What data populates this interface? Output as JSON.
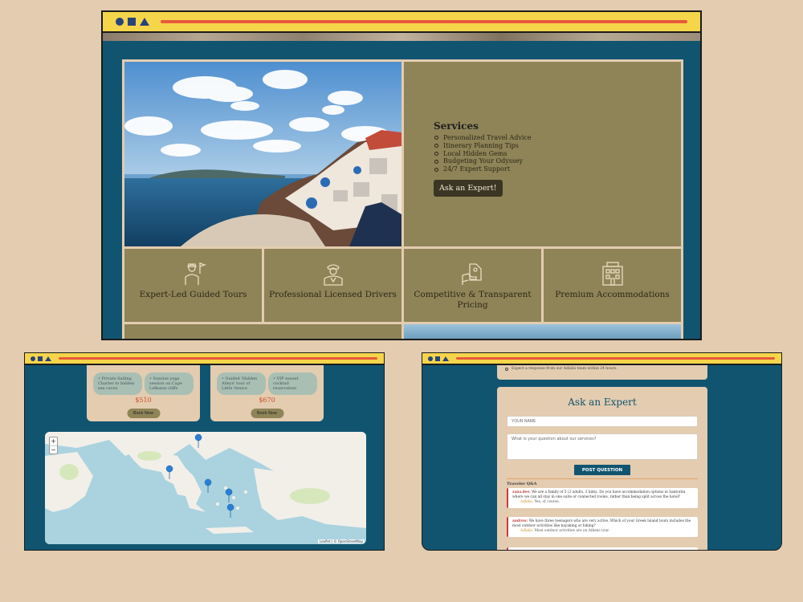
{
  "services": {
    "title": "Services",
    "items": [
      "Personalized Travel Advice",
      "Itinerary Planning Tips",
      "Local Hidden Gems",
      "Budgeting Your Odyssey",
      "24/7 Expert Support"
    ],
    "cta": "Ask an Expert!"
  },
  "features": [
    {
      "label": "Expert-Led Guided Tours",
      "icon": "tour-guide-icon"
    },
    {
      "label": "Professional Licensed Drivers",
      "icon": "driver-icon"
    },
    {
      "label": "Competitive & Transparent Pricing",
      "icon": "pricing-icon"
    },
    {
      "label": "Premium Accommodations",
      "icon": "hotel-icon"
    }
  ],
  "tours": [
    {
      "features": [
        "• Private Sailing Charter to hidden sea caves",
        "• Sunrise yoga session on Cape Lefkatas cliffs"
      ],
      "price": "$510",
      "book": "Book Now"
    },
    {
      "features": [
        "• Guided 'Hidden Alleys' tour of Little Venice",
        "• VIP sunset cocktail reservation"
      ],
      "price": "$670",
      "book": "Book Now"
    }
  ],
  "map": {
    "zoom_in": "+",
    "zoom_out": "−",
    "attribution": "Leaflet | © OpenStreetMap"
  },
  "ask": {
    "top_note": "Expect a response from our Adlalis team within 24 hours.",
    "title": "Ask an Expert",
    "name_placeholder": "YOUR NAME",
    "question_placeholder": "What is your question about our services?",
    "post": "POST QUESTION",
    "qa_title": "Traveler Q&A",
    "qa": [
      {
        "user": "zana.dee:",
        "q": "We are a family of 5 (2 adults, 3 kids). Do you have accommodation options in Santorini where we can all stay in one suite or connected rooms, rather than being split across the hotel?",
        "agent": "Adlalis:",
        "a": "Yes, of course."
      },
      {
        "user": "andrew:",
        "q": "We have three teenagers who are very active. Which of your Greek Island tours includes the most outdoor activities like kayaking or biking?",
        "agent": "Adlalis:",
        "a": "Most outdoor activities are on Athens tour."
      }
    ]
  },
  "colors": {
    "window_bg": "#115470",
    "titlebar": "#f5d54a",
    "accent_bar": "#e85a3c",
    "panel": "#8f8458",
    "page_bg": "#e3ccb0",
    "price": "#d24b2a"
  }
}
